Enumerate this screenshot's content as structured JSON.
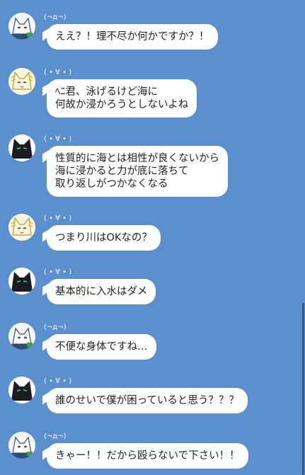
{
  "colors": {
    "background": "#5b8fcd",
    "bubble": "#ffffff",
    "text": "#222222",
    "sender": "#ffffff"
  },
  "messages": [
    {
      "avatar": "white-cat-avatar",
      "sender": "(¬д¬)",
      "text": "ええ？！理不尽か何かですか？！"
    },
    {
      "avatar": "cream-cat-avatar",
      "sender": "( • ∀ • )",
      "text": "ﾍﾆ君、泳げるけど海に\n何故か浸かろうとしないよね"
    },
    {
      "avatar": "black-cat-avatar",
      "sender": "( • ∀ • )",
      "text": "性質的に海とは相性が良くないから\n海に浸かると力が底に落ちて\n取り返しがつかなくなる"
    },
    {
      "avatar": "cream-cat-avatar",
      "sender": "( • ∀ • )",
      "text": "つまり川はOKなの？"
    },
    {
      "avatar": "black-cat-avatar",
      "sender": "( • ∀ • )",
      "text": "基本的に入水はダメ"
    },
    {
      "avatar": "white-cat-avatar",
      "sender": "(¬д¬)",
      "text": "不便な身体ですね…"
    },
    {
      "avatar": "black-cat-avatar",
      "sender": "( • ∀ • )",
      "text": "誰のせいで僕が困っていると思う？？？"
    },
    {
      "avatar": "white-cat-avatar",
      "sender": "(¬д¬)",
      "text": "きゃー！！だから殴らないで下さい！！"
    }
  ]
}
